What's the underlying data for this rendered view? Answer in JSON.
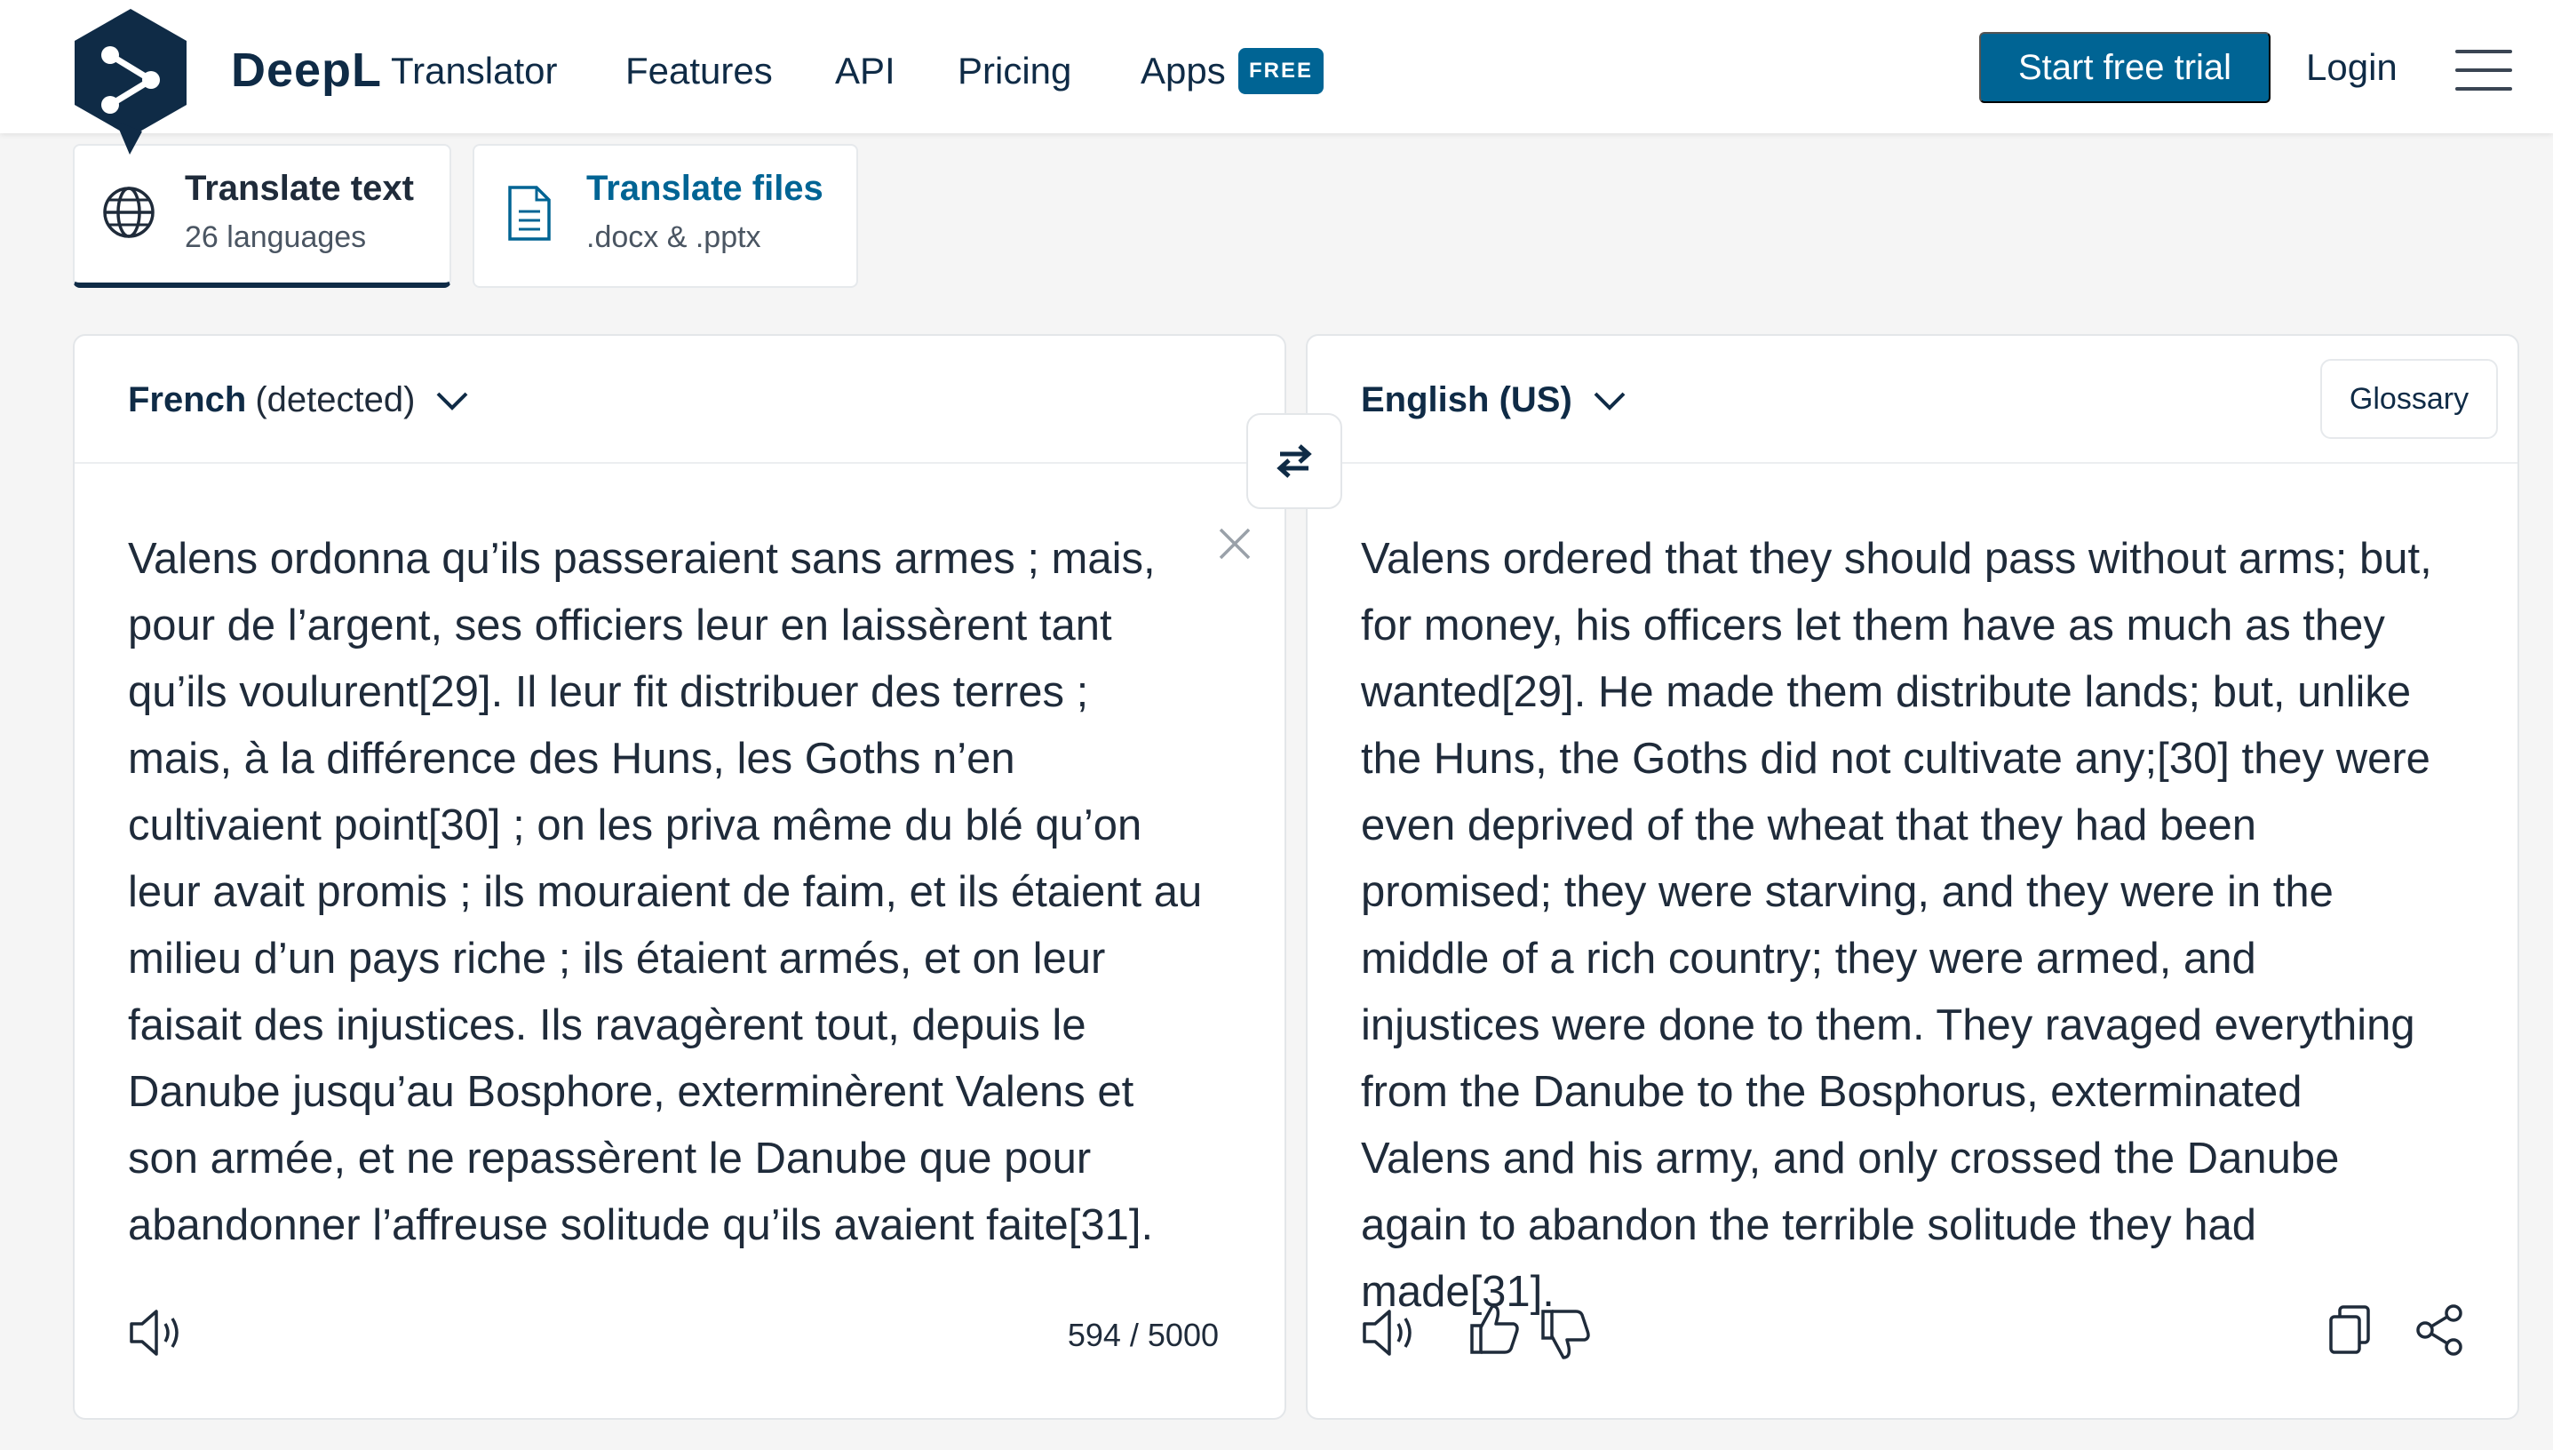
{
  "header": {
    "brand": "DeepL",
    "brand_sub": "Translator",
    "nav": {
      "features": "Features",
      "api": "API",
      "pricing": "Pricing",
      "apps": "Apps",
      "apps_badge": "FREE"
    },
    "trial_label": "Start free trial",
    "login_label": "Login"
  },
  "modes": {
    "text": {
      "title": "Translate text",
      "sub": "26 languages"
    },
    "files": {
      "title": "Translate files",
      "sub": ".docx & .pptx"
    }
  },
  "source": {
    "language": "French",
    "detected": "(detected)",
    "text": "Valens ordonna qu’ils passeraient sans armes ; mais, pour de l’argent, ses officiers leur en laissèrent tant qu’ils voulurent[29]. Il leur fit distribuer des terres ; mais, à la différence des Huns, les Goths n’en cultivaient point[30] ; on les priva même du blé qu’on leur avait promis ; ils mouraient de faim, et ils étaient au milieu d’un pays riche ; ils étaient armés, et on leur faisait des injustices. Ils ravagèrent tout, depuis le Danube jusqu’au Bosphore, exterminèrent Valens et son armée, et ne repassèrent le Danube que pour abandonner l’affreuse solitude qu’ils avaient faite[31].",
    "char_count": "594 / 5000"
  },
  "target": {
    "language": "English (US)",
    "glossary_label": "Glossary",
    "text": "Valens ordered that they should pass without arms; but, for money, his officers let them have as much as they wanted[29]. He made them distribute lands; but, unlike the Huns, the Goths did not cultivate any;[30] they were even deprived of the wheat that they had been promised; they were starving, and they were in the middle of a rich country; they were armed, and injustices were done to them. They ravaged everything from the Danube to the Bosphorus, exterminated Valens and his army, and only crossed the Danube again to abandon the terrible solitude they had made[31]."
  },
  "colors": {
    "brand_navy": "#0f2b46",
    "accent_blue": "#006494",
    "page_bg": "#f5f5f5"
  }
}
